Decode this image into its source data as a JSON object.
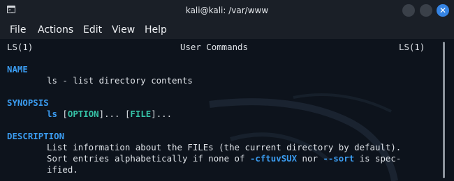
{
  "window": {
    "title": "kali@kali: /var/www",
    "close_glyph": "✕",
    "icon": "terminal-icon"
  },
  "menu": [
    "File",
    "Actions",
    "Edit",
    "View",
    "Help"
  ],
  "man": {
    "header_left": "LS(1)",
    "header_center": "User Commands",
    "header_right": "LS(1)",
    "name_heading": "NAME",
    "name_text": "ls - list directory contents",
    "synopsis_heading": "SYNOPSIS",
    "synopsis": {
      "cmd": "ls",
      "lb1": "[",
      "option": "OPTION",
      "rb1": "]",
      "dots1": "... ",
      "lb2": "[",
      "file": "FILE",
      "rb2": "]",
      "dots2": "..."
    },
    "description_heading": "DESCRIPTION",
    "desc_line1": "List information about the FILEs (the current directory by default).",
    "desc_line2": {
      "a": "Sort entries alphabetically if none of ",
      "flags": "-cftuvSUX",
      "b": " nor ",
      "sort": "--sort",
      "c": " is spec-"
    },
    "desc_line3": "ified."
  },
  "colors": {
    "background": "#0d131c",
    "heading": "#3b9cf0",
    "option": "#36c4a8",
    "close_button": "#3584e4"
  }
}
